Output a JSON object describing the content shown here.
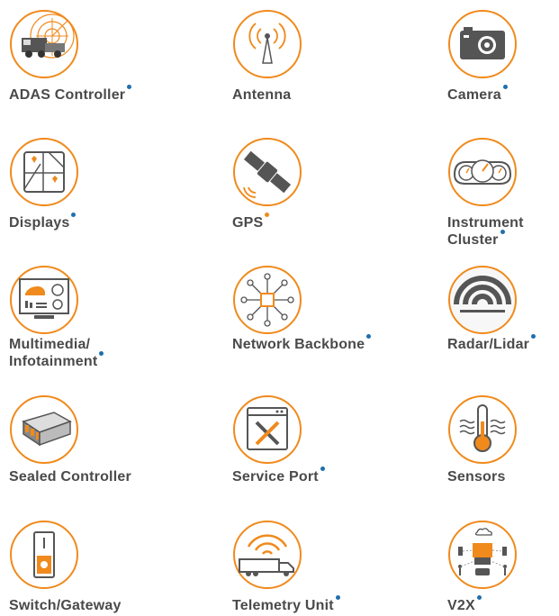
{
  "colors": {
    "accent": "#f08a1c",
    "text": "#4a4a4a",
    "dot_blue": "#1f6fae",
    "dot_orange": "#f08a1c"
  },
  "items": [
    {
      "label_lines": [
        "ADAS Controller"
      ],
      "dot": "blue",
      "icon": "adas-truck-radar-icon"
    },
    {
      "label_lines": [
        "Antenna"
      ],
      "dot": "none",
      "icon": "antenna-icon"
    },
    {
      "label_lines": [
        "Camera"
      ],
      "dot": "blue",
      "icon": "camera-icon"
    },
    {
      "label_lines": [
        "Displays"
      ],
      "dot": "blue",
      "icon": "map-display-icon"
    },
    {
      "label_lines": [
        "GPS"
      ],
      "dot": "orange",
      "icon": "satellite-icon"
    },
    {
      "label_lines": [
        "Instrument",
        "Cluster"
      ],
      "dot": "blue",
      "icon": "gauges-icon"
    },
    {
      "label_lines": [
        "Multimedia/",
        "Infotainment"
      ],
      "dot": "blue",
      "icon": "monitor-icon"
    },
    {
      "label_lines": [
        "Network Backbone"
      ],
      "dot": "blue",
      "icon": "network-icon"
    },
    {
      "label_lines": [
        "Radar/Lidar"
      ],
      "dot": "blue",
      "icon": "radar-waves-icon"
    },
    {
      "label_lines": [
        "Sealed Controller"
      ],
      "dot": "none",
      "icon": "controller-box-icon"
    },
    {
      "label_lines": [
        "Service Port"
      ],
      "dot": "blue",
      "icon": "tools-window-icon"
    },
    {
      "label_lines": [
        "Sensors"
      ],
      "dot": "none",
      "icon": "thermometer-icon"
    },
    {
      "label_lines": [
        "Switch/Gateway"
      ],
      "dot": "none",
      "icon": "switch-icon"
    },
    {
      "label_lines": [
        "Telemetry Unit"
      ],
      "dot": "blue",
      "icon": "truck-signal-icon"
    },
    {
      "label_lines": [
        "V2X"
      ],
      "dot": "blue",
      "icon": "v2x-icon"
    }
  ]
}
